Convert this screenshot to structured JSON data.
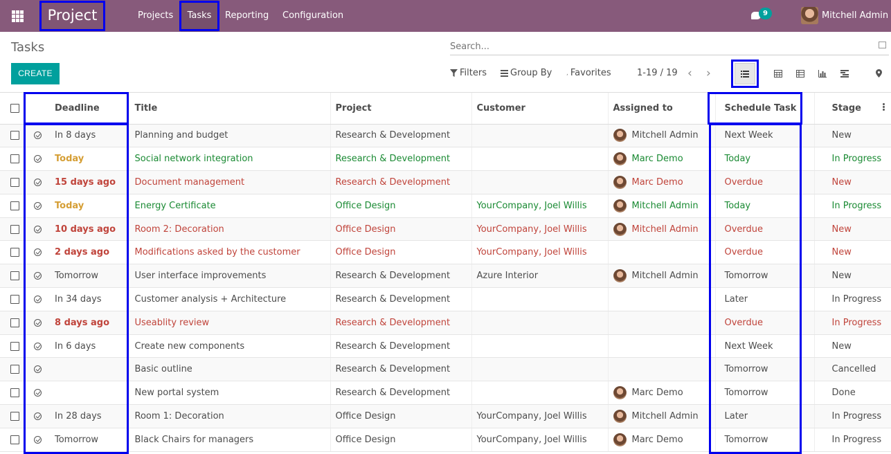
{
  "navbar": {
    "brand": "Project",
    "menu": [
      "Projects",
      "Tasks",
      "Reporting",
      "Configuration"
    ],
    "messages_count": "9",
    "user_name": "Mitchell Admin"
  },
  "control_panel": {
    "breadcrumb": "Tasks",
    "create_label": "CREATE",
    "search_placeholder": "Search...",
    "filters_label": "Filters",
    "groupby_label": "Group By",
    "favorites_label": "Favorites",
    "pager": "1-19 / 19"
  },
  "table": {
    "columns": [
      "Deadline",
      "Title",
      "Project",
      "Customer",
      "Assigned to",
      "Schedule Task",
      "Stage"
    ],
    "rows": [
      {
        "deadline": "In 8 days",
        "deadline_state": "normal",
        "title": "Planning and budget",
        "project": "Research & Development",
        "customer": "",
        "assigned": "Mitchell Admin",
        "schedule": "Next Week",
        "stage": "New",
        "state": "normal"
      },
      {
        "deadline": "Today",
        "deadline_state": "warning",
        "title": "Social network integration",
        "project": "Research & Development",
        "customer": "",
        "assigned": "Marc Demo",
        "schedule": "Today",
        "stage": "In Progress",
        "state": "success"
      },
      {
        "deadline": "15 days ago",
        "deadline_state": "danger",
        "title": "Document management",
        "project": "Research & Development",
        "customer": "",
        "assigned": "Marc Demo",
        "schedule": "Overdue",
        "stage": "New",
        "state": "danger"
      },
      {
        "deadline": "Today",
        "deadline_state": "warning",
        "title": "Energy Certificate",
        "project": "Office Design",
        "customer": "YourCompany, Joel Willis",
        "assigned": "Mitchell Admin",
        "schedule": "Today",
        "stage": "In Progress",
        "state": "success"
      },
      {
        "deadline": "10 days ago",
        "deadline_state": "danger",
        "title": "Room 2: Decoration",
        "project": "Office Design",
        "customer": "YourCompany, Joel Willis",
        "assigned": "Mitchell Admin",
        "schedule": "Overdue",
        "stage": "New",
        "state": "danger"
      },
      {
        "deadline": "2 days ago",
        "deadline_state": "danger",
        "title": "Modifications asked by the customer",
        "project": "Office Design",
        "customer": "YourCompany, Joel Willis",
        "assigned": "",
        "schedule": "Overdue",
        "stage": "New",
        "state": "danger"
      },
      {
        "deadline": "Tomorrow",
        "deadline_state": "normal",
        "title": "User interface improvements",
        "project": "Research & Development",
        "customer": "Azure Interior",
        "assigned": "Mitchell Admin",
        "schedule": "Tomorrow",
        "stage": "New",
        "state": "normal"
      },
      {
        "deadline": "In 34 days",
        "deadline_state": "normal",
        "title": "Customer analysis + Architecture",
        "project": "Research & Development",
        "customer": "",
        "assigned": "",
        "schedule": "Later",
        "stage": "In Progress",
        "state": "normal"
      },
      {
        "deadline": "8 days ago",
        "deadline_state": "danger",
        "title": "Useablity review",
        "project": "Research & Development",
        "customer": "",
        "assigned": "",
        "schedule": "Overdue",
        "stage": "In Progress",
        "state": "danger"
      },
      {
        "deadline": "In 6 days",
        "deadline_state": "normal",
        "title": "Create new components",
        "project": "Research & Development",
        "customer": "",
        "assigned": "",
        "schedule": "Next Week",
        "stage": "New",
        "state": "normal"
      },
      {
        "deadline": "",
        "deadline_state": "normal",
        "title": "Basic outline",
        "project": "Research & Development",
        "customer": "",
        "assigned": "",
        "schedule": "Tomorrow",
        "stage": "Cancelled",
        "state": "normal"
      },
      {
        "deadline": "",
        "deadline_state": "normal",
        "title": "New portal system",
        "project": "Research & Development",
        "customer": "",
        "assigned": "Marc Demo",
        "schedule": "Tomorrow",
        "stage": "Done",
        "state": "normal"
      },
      {
        "deadline": "In 28 days",
        "deadline_state": "normal",
        "title": "Room 1: Decoration",
        "project": "Office Design",
        "customer": "YourCompany, Joel Willis",
        "assigned": "Mitchell Admin",
        "schedule": "Later",
        "stage": "In Progress",
        "state": "normal"
      },
      {
        "deadline": "Tomorrow",
        "deadline_state": "normal",
        "title": "Black Chairs for managers",
        "project": "Office Design",
        "customer": "YourCompany, Joel Willis",
        "assigned": "Marc Demo",
        "schedule": "Tomorrow",
        "stage": "In Progress",
        "state": "normal"
      }
    ]
  }
}
